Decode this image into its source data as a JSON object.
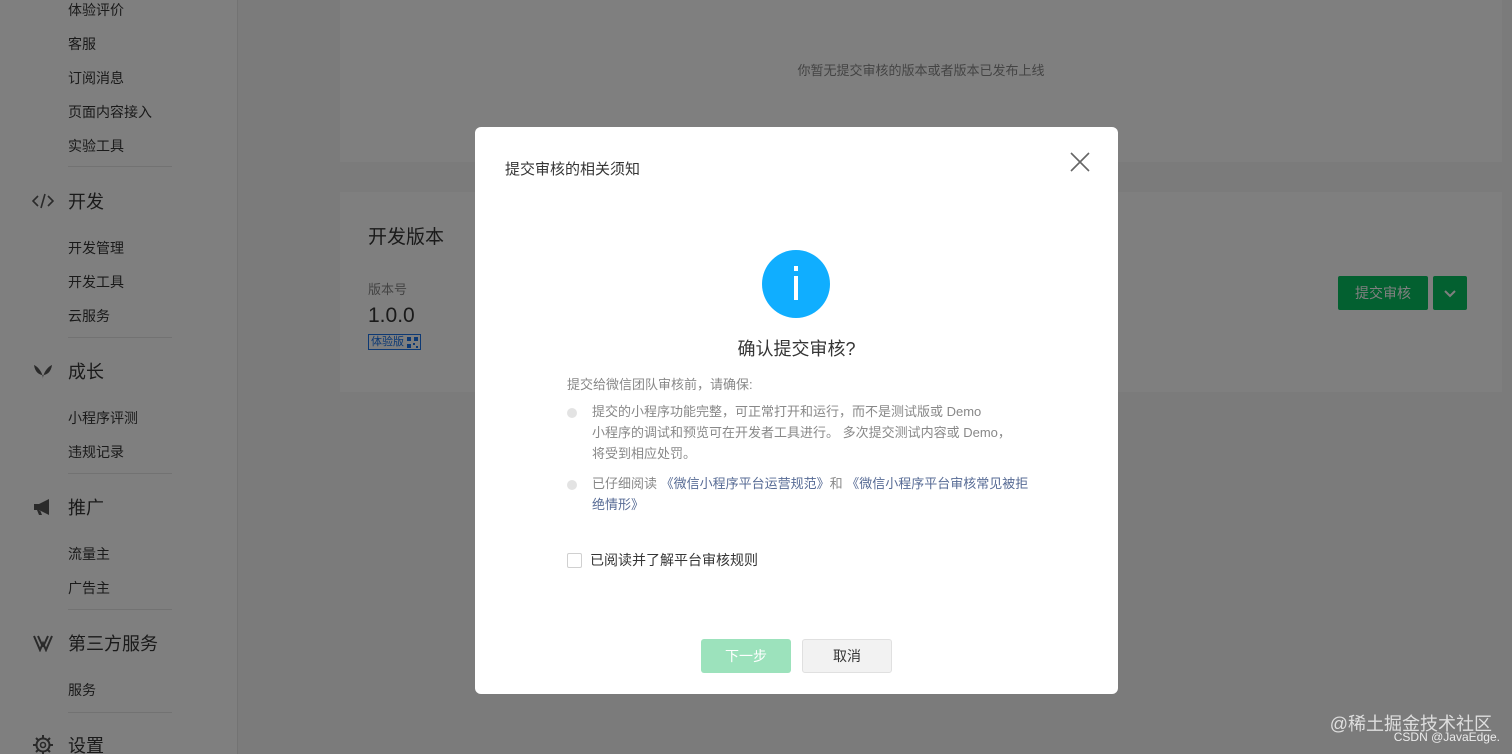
{
  "sidebar": {
    "top_items": [
      {
        "label": "体验评价"
      },
      {
        "label": "客服"
      },
      {
        "label": "订阅消息"
      },
      {
        "label": "页面内容接入"
      },
      {
        "label": "实验工具"
      }
    ],
    "sections": [
      {
        "title": "开发",
        "icon": "code-icon",
        "items": [
          "开发管理",
          "开发工具",
          "云服务"
        ]
      },
      {
        "title": "成长",
        "icon": "leaf-icon",
        "items": [
          "小程序评测",
          "违规记录"
        ]
      },
      {
        "title": "推广",
        "icon": "megaphone-icon",
        "items": [
          "流量主",
          "广告主"
        ]
      },
      {
        "title": "第三方服务",
        "icon": "third-party-icon",
        "items": [
          "服务"
        ]
      },
      {
        "title": "设置",
        "icon": "gear-icon",
        "items": []
      }
    ]
  },
  "main": {
    "empty_text": "你暂无提交审核的版本或者版本已发布上线",
    "dev": {
      "title": "开发版本",
      "version_label": "版本号",
      "version": "1.0.0",
      "tag": "体验版",
      "submit_label": "提交审核"
    }
  },
  "modal": {
    "title": "提交审核的相关须知",
    "confirm_title": "确认提交审核?",
    "ensure_text": "提交给微信团队审核前，请确保:",
    "rule1_line1": "提交的小程序功能完整，可正常打开和运行，而不是测试版或 Demo",
    "rule1_line2": "小程序的调试和预览可在开发者工具进行。 多次提交测试内容或 Demo，",
    "rule1_line3": "将受到相应处罚。",
    "rule2_prefix": "已仔细阅读 ",
    "rule2_link1": "《微信小程序平台运营规范》",
    "rule2_mid": "和 ",
    "rule2_link2": "《微信小程序平台审核常见被拒绝情形》",
    "checkbox_label": "已阅读并了解平台审核规则",
    "next_label": "下一步",
    "cancel_label": "取消"
  },
  "watermark": {
    "line1": "@稀土掘金技术社区",
    "line2": "CSDN @JavaEdge."
  },
  "colors": {
    "accent_green": "#07c160",
    "info_blue": "#10aeff",
    "link": "#576b95"
  }
}
